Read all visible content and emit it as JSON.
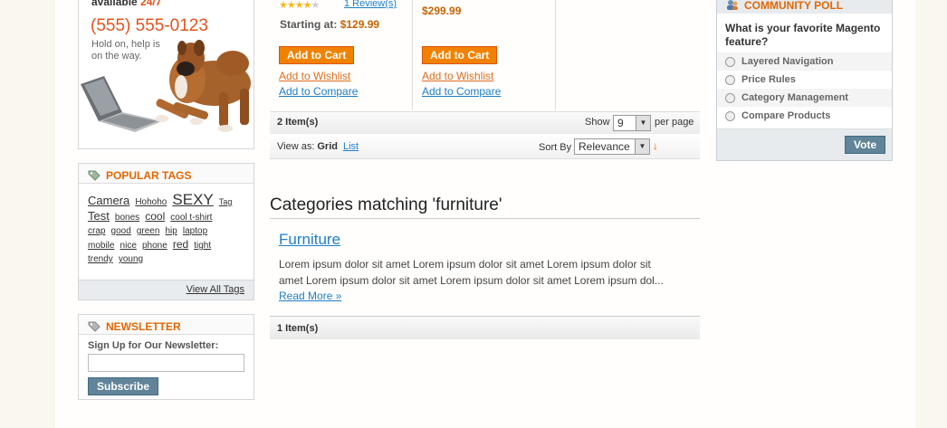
{
  "help": {
    "available_prefix": "available",
    "available_hours": "24/7",
    "phone": "(555) 555-0123",
    "text": "Hold on, help is on the way."
  },
  "tags": {
    "title": "POPULAR TAGS",
    "items": [
      {
        "label": "Camera",
        "size": 13
      },
      {
        "label": "Hohoho",
        "size": 10
      },
      {
        "label": "SEXY",
        "size": 17
      },
      {
        "label": "Tag",
        "size": 9
      },
      {
        "label": "Test",
        "size": 13
      },
      {
        "label": "bones",
        "size": 10
      },
      {
        "label": "cool",
        "size": 12
      },
      {
        "label": "cool t-shirt",
        "size": 10
      },
      {
        "label": "crap",
        "size": 10
      },
      {
        "label": "good",
        "size": 10
      },
      {
        "label": "green",
        "size": 10
      },
      {
        "label": "hip",
        "size": 10
      },
      {
        "label": "laptop",
        "size": 10
      },
      {
        "label": "mobile",
        "size": 10
      },
      {
        "label": "nice",
        "size": 10
      },
      {
        "label": "phone",
        "size": 10
      },
      {
        "label": "red",
        "size": 12
      },
      {
        "label": "tight",
        "size": 10
      },
      {
        "label": "trendy",
        "size": 10
      },
      {
        "label": "young",
        "size": 10
      }
    ],
    "view_all": "View All Tags"
  },
  "newsletter": {
    "title": "NEWSLETTER",
    "label": "Sign Up for Our Newsletter:",
    "input_value": "",
    "button": "Subscribe"
  },
  "products": {
    "col1": {
      "rating_stars": 4,
      "rating_max": 5,
      "reviews": "1 Review(s)",
      "starting_label": "Starting at:",
      "price": "$129.99",
      "add_to_cart": "Add to Cart",
      "wishlist": "Add to Wishlist",
      "compare": "Add to Compare"
    },
    "col2": {
      "price": "$299.99",
      "add_to_cart": "Add to Cart",
      "wishlist": "Add to Wishlist",
      "compare": "Add to Compare"
    }
  },
  "pager": {
    "count": "2 Item(s)",
    "show_label": "Show",
    "show_value": "9",
    "per_page": "per page"
  },
  "sorter": {
    "view_as": "View as:",
    "grid": "Grid",
    "list": "List",
    "sort_by": "Sort By",
    "sort_value": "Relevance",
    "direction_icon": "↓"
  },
  "categories": {
    "heading": "Categories matching 'furniture'",
    "name": "Furniture",
    "description_line1": "Lorem ipsum dolor sit amet Lorem ipsum dolor sit amet Lorem ipsum dolor sit",
    "description_line2": "amet Lorem ipsum dolor sit amet Lorem ipsum dolor sit amet Lorem ipsum dol...",
    "read_more": "Read More »",
    "count": "1 Item(s)"
  },
  "poll": {
    "title": "COMMUNITY POLL",
    "question": "What is your favorite Magento feature?",
    "options": [
      "Layered Navigation",
      "Price Rules",
      "Category Management",
      "Compare Products"
    ],
    "vote": "Vote"
  },
  "colors": {
    "accent_orange": "#e26703",
    "link_blue": "#1e7ec8",
    "button_orange": "#f18200",
    "button_blue": "#618499"
  }
}
